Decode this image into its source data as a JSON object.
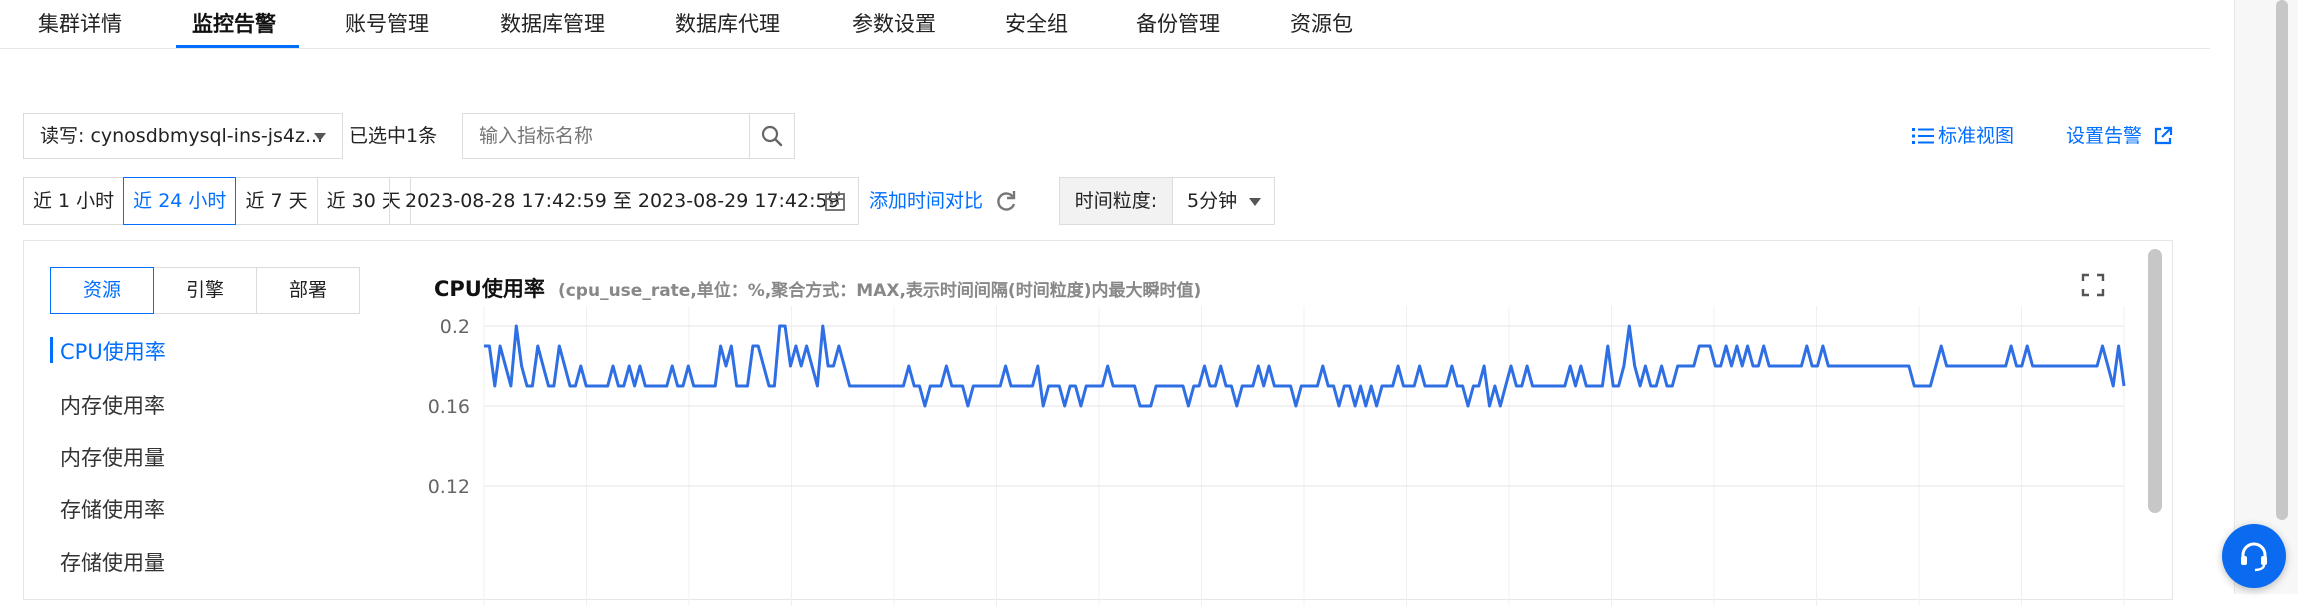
{
  "tabs": [
    {
      "label": "集群详情",
      "active": false
    },
    {
      "label": "监控告警",
      "active": true
    },
    {
      "label": "账号管理",
      "active": false
    },
    {
      "label": "数据库管理",
      "active": false
    },
    {
      "label": "数据库代理",
      "active": false
    },
    {
      "label": "参数设置",
      "active": false
    },
    {
      "label": "安全组",
      "active": false
    },
    {
      "label": "备份管理",
      "active": false
    },
    {
      "label": "资源包",
      "active": false
    }
  ],
  "toolbar": {
    "instance_select": "读写: cynosdbmysql-ins-js4z...",
    "selected_count": "已选中1条",
    "search_placeholder": "输入指标名称",
    "standard_view": "标准视图",
    "set_alarm": "设置告警"
  },
  "time": {
    "ranges": [
      {
        "label": "近 1 小时",
        "active": false
      },
      {
        "label": "近 24 小时",
        "active": true
      },
      {
        "label": "近 7 天",
        "active": false
      },
      {
        "label": "近 30 天",
        "active": false
      }
    ],
    "date_range": "2023-08-28 17:42:59 至 2023-08-29 17:42:59",
    "add_compare": "添加时间对比",
    "granularity_label": "时间粒度:",
    "granularity_value": "5分钟"
  },
  "panel": {
    "segments": [
      {
        "label": "资源",
        "active": true
      },
      {
        "label": "引擎",
        "active": false
      },
      {
        "label": "部署",
        "active": false
      }
    ],
    "metrics": [
      {
        "label": "CPU使用率",
        "active": true
      },
      {
        "label": "内存使用率",
        "active": false
      },
      {
        "label": "内存使用量",
        "active": false
      },
      {
        "label": "存储使用率",
        "active": false
      },
      {
        "label": "存储使用量",
        "active": false
      }
    ]
  },
  "colors": {
    "accent": "#006eff",
    "line": "#2f6fe4"
  },
  "chart_data": {
    "type": "line",
    "title": "CPU使用率",
    "subtitle": "(cpu_use_rate,单位：%,聚合方式：MAX,表示时间间隔(时间粒度)内最大瞬时值)",
    "y_ticks": [
      "0.2",
      "0.16",
      "0.12"
    ],
    "ylim": [
      0.1,
      0.21
    ],
    "grid": true,
    "series": [
      {
        "values": [
          0.19,
          0.19,
          0.17,
          0.19,
          0.18,
          0.17,
          0.2,
          0.18,
          0.17,
          0.17,
          0.19,
          0.18,
          0.17,
          0.17,
          0.19,
          0.18,
          0.17,
          0.17,
          0.18,
          0.17,
          0.17,
          0.17,
          0.17,
          0.17,
          0.18,
          0.17,
          0.17,
          0.18,
          0.17,
          0.18,
          0.17,
          0.17,
          0.17,
          0.17,
          0.17,
          0.18,
          0.17,
          0.17,
          0.18,
          0.17,
          0.17,
          0.17,
          0.17,
          0.17,
          0.19,
          0.18,
          0.19,
          0.17,
          0.17,
          0.17,
          0.19,
          0.19,
          0.18,
          0.17,
          0.17,
          0.2,
          0.2,
          0.18,
          0.19,
          0.18,
          0.19,
          0.18,
          0.17,
          0.2,
          0.18,
          0.18,
          0.19,
          0.18,
          0.17,
          0.17,
          0.17,
          0.17,
          0.17,
          0.17,
          0.17,
          0.17,
          0.17,
          0.17,
          0.17,
          0.18,
          0.17,
          0.17,
          0.16,
          0.17,
          0.17,
          0.17,
          0.18,
          0.17,
          0.17,
          0.17,
          0.16,
          0.17,
          0.17,
          0.17,
          0.17,
          0.17,
          0.17,
          0.18,
          0.17,
          0.17,
          0.17,
          0.17,
          0.17,
          0.18,
          0.16,
          0.17,
          0.17,
          0.17,
          0.16,
          0.17,
          0.17,
          0.16,
          0.17,
          0.17,
          0.17,
          0.17,
          0.18,
          0.17,
          0.17,
          0.17,
          0.17,
          0.17,
          0.16,
          0.16,
          0.16,
          0.17,
          0.17,
          0.17,
          0.17,
          0.17,
          0.17,
          0.16,
          0.17,
          0.17,
          0.18,
          0.17,
          0.17,
          0.18,
          0.17,
          0.17,
          0.16,
          0.17,
          0.17,
          0.17,
          0.18,
          0.17,
          0.18,
          0.17,
          0.17,
          0.17,
          0.17,
          0.16,
          0.17,
          0.17,
          0.17,
          0.17,
          0.18,
          0.17,
          0.17,
          0.16,
          0.17,
          0.17,
          0.16,
          0.17,
          0.16,
          0.17,
          0.16,
          0.17,
          0.17,
          0.17,
          0.18,
          0.17,
          0.17,
          0.17,
          0.18,
          0.17,
          0.17,
          0.17,
          0.17,
          0.17,
          0.18,
          0.17,
          0.17,
          0.16,
          0.17,
          0.17,
          0.18,
          0.16,
          0.17,
          0.16,
          0.17,
          0.18,
          0.17,
          0.17,
          0.18,
          0.17,
          0.17,
          0.17,
          0.17,
          0.17,
          0.17,
          0.17,
          0.18,
          0.17,
          0.18,
          0.17,
          0.17,
          0.17,
          0.17,
          0.19,
          0.17,
          0.17,
          0.18,
          0.2,
          0.18,
          0.17,
          0.18,
          0.17,
          0.17,
          0.18,
          0.17,
          0.17,
          0.18,
          0.18,
          0.18,
          0.18,
          0.19,
          0.19,
          0.19,
          0.18,
          0.18,
          0.19,
          0.18,
          0.19,
          0.18,
          0.19,
          0.18,
          0.18,
          0.19,
          0.18,
          0.18,
          0.18,
          0.18,
          0.18,
          0.18,
          0.18,
          0.19,
          0.18,
          0.18,
          0.19,
          0.18,
          0.18,
          0.18,
          0.18,
          0.18,
          0.18,
          0.18,
          0.18,
          0.18,
          0.18,
          0.18,
          0.18,
          0.18,
          0.18,
          0.18,
          0.18,
          0.17,
          0.17,
          0.17,
          0.17,
          0.18,
          0.19,
          0.18,
          0.18,
          0.18,
          0.18,
          0.18,
          0.18,
          0.18,
          0.18,
          0.18,
          0.18,
          0.18,
          0.18,
          0.19,
          0.18,
          0.18,
          0.19,
          0.18,
          0.18,
          0.18,
          0.18,
          0.18,
          0.18,
          0.18,
          0.18,
          0.18,
          0.18,
          0.18,
          0.18,
          0.18,
          0.19,
          0.18,
          0.17,
          0.19,
          0.17
        ]
      }
    ]
  }
}
